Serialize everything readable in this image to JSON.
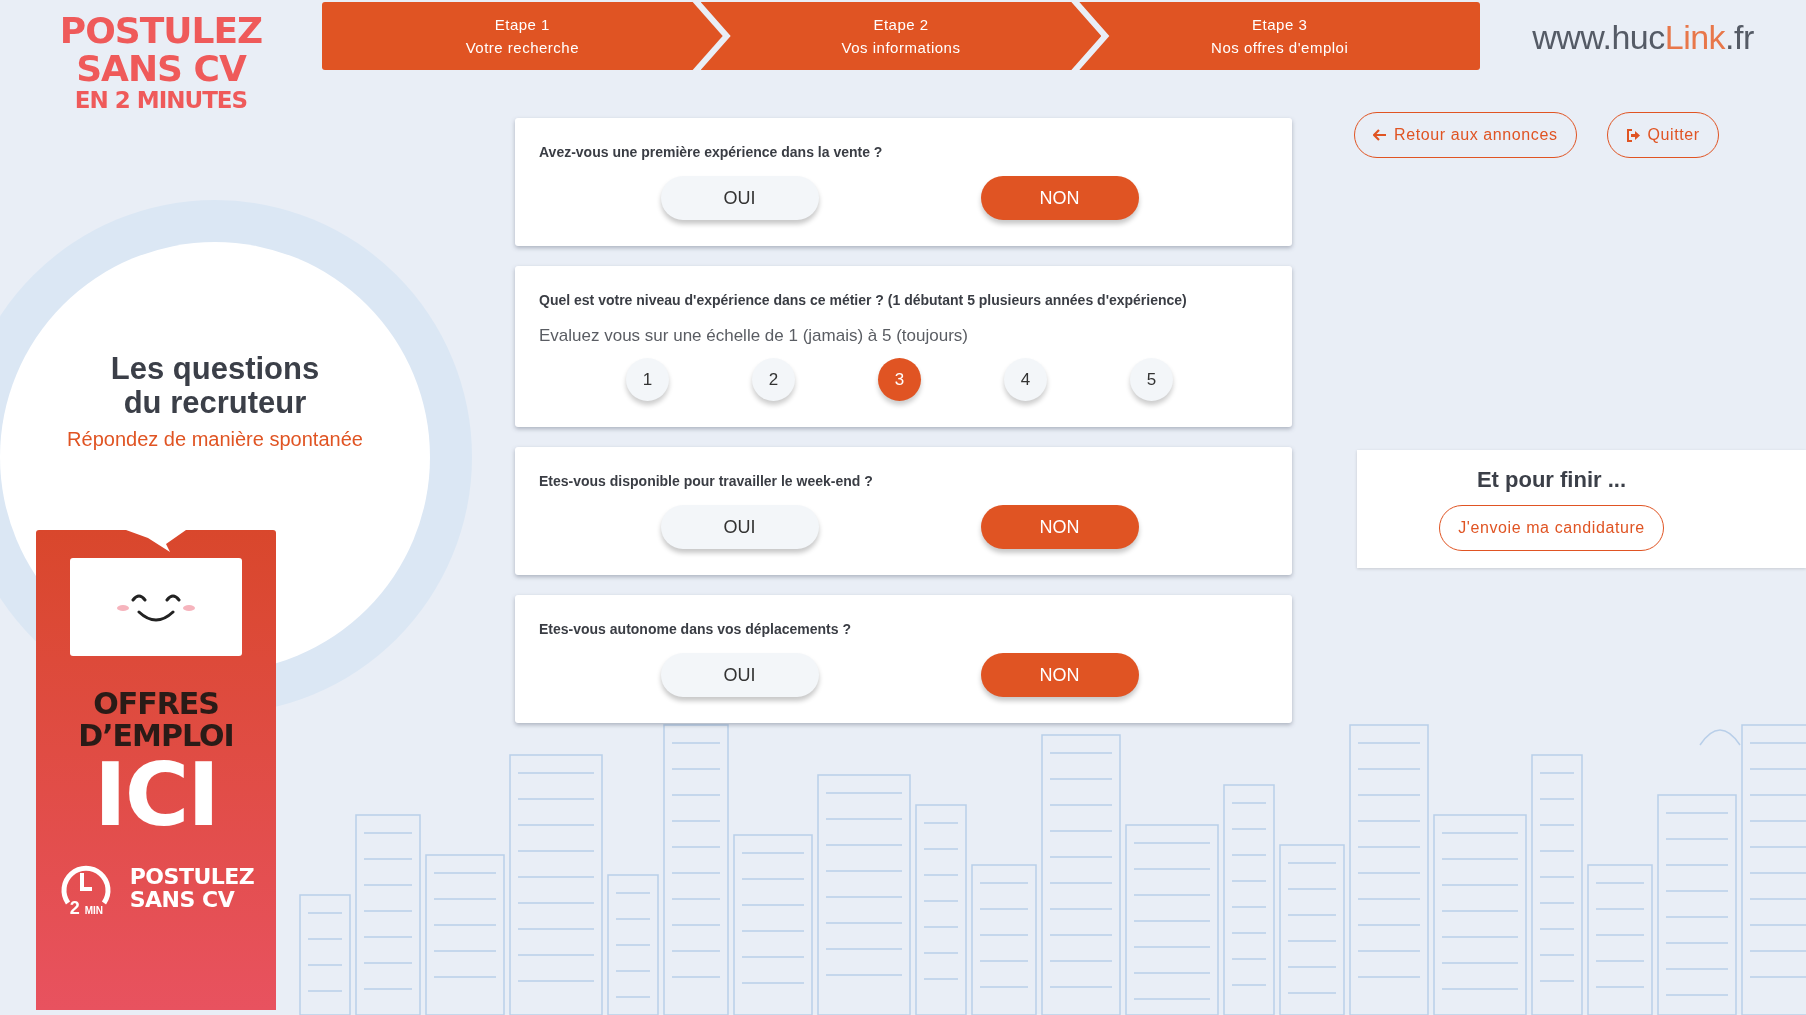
{
  "logo": {
    "lines": [
      "POSTULEZ",
      "SANS CV",
      "EN 2 MINUTES"
    ]
  },
  "steps": [
    {
      "title": "Etape 1",
      "label": "Votre recherche"
    },
    {
      "title": "Etape 2",
      "label": "Vos informations"
    },
    {
      "title": "Etape 3",
      "label": "Nos offres d'emploi"
    }
  ],
  "brand": {
    "prefix": "www.huc",
    "highlight": "Link",
    "suffix": ".fr"
  },
  "intro": {
    "title_lines": [
      "Les questions",
      "du recruteur"
    ],
    "subtitle": "Répondez de manière spontanée"
  },
  "poster": {
    "headline_lines": [
      "OFFRES",
      "D’EMPLOI"
    ],
    "big_word": "ICI",
    "badge_number": "2",
    "badge_unit": "MIN",
    "tagline_lines": [
      "POSTULEZ",
      "SANS CV"
    ]
  },
  "questions": [
    {
      "kind": "yesno",
      "text": "Avez-vous une première expérience dans la vente ?",
      "options": [
        {
          "label": "OUI",
          "selected": false
        },
        {
          "label": "NON",
          "selected": true
        }
      ]
    },
    {
      "kind": "scale",
      "text": "Quel est votre niveau d'expérience dans ce métier ? (1 débutant 5 plusieurs années d'expérience)",
      "hint": "Evaluez vous sur une échelle de 1 (jamais) à 5 (toujours)",
      "options": [
        {
          "label": "1",
          "selected": false
        },
        {
          "label": "2",
          "selected": false
        },
        {
          "label": "3",
          "selected": true
        },
        {
          "label": "4",
          "selected": false
        },
        {
          "label": "5",
          "selected": false
        }
      ]
    },
    {
      "kind": "yesno",
      "text": "Etes-vous disponible pour travailler le week-end ?",
      "options": [
        {
          "label": "OUI",
          "selected": false
        },
        {
          "label": "NON",
          "selected": true
        }
      ]
    },
    {
      "kind": "yesno",
      "text": "Etes-vous autonome dans vos déplacements ?",
      "options": [
        {
          "label": "OUI",
          "selected": false
        },
        {
          "label": "NON",
          "selected": true
        }
      ]
    }
  ],
  "actions": [
    {
      "kind": "back",
      "label": "Retour aux annonces"
    },
    {
      "kind": "exit",
      "label": "Quitter"
    }
  ],
  "finish": {
    "title": "Et pour finir ...",
    "button": "J'envoie ma candidature"
  }
}
